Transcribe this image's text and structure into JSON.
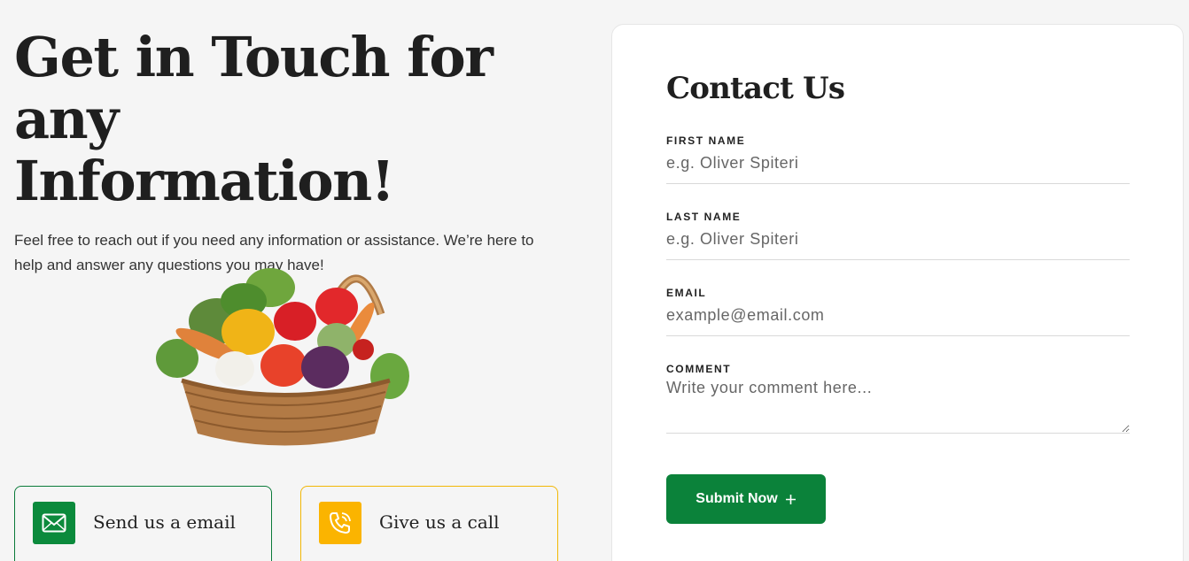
{
  "hero": {
    "headline_line1": "Get in Touch for any",
    "headline_line2": "Information!",
    "intro": "Feel free to reach out if you need any information or assistance. We’re here to help and answer any questions you may have!"
  },
  "cards": {
    "email": {
      "title": "Send us a email",
      "icon": "envelope-icon",
      "color": "#0b8a3c"
    },
    "call": {
      "title": "Give us a call",
      "icon": "phone-icon",
      "color": "#fbb400"
    }
  },
  "form": {
    "title": "Contact Us",
    "first_name": {
      "label": "FIRST NAME",
      "placeholder": "e.g. Oliver Spiteri"
    },
    "last_name": {
      "label": "LAST NAME",
      "placeholder": "e.g. Oliver Spiteri"
    },
    "email": {
      "label": "EMAIL",
      "placeholder": "example@email.com"
    },
    "comment": {
      "label": "COMMENT",
      "placeholder": "Write your comment here..."
    },
    "submit_label": "Submit Now",
    "submit_icon": "plus-icon",
    "accent": "#0b823a"
  }
}
